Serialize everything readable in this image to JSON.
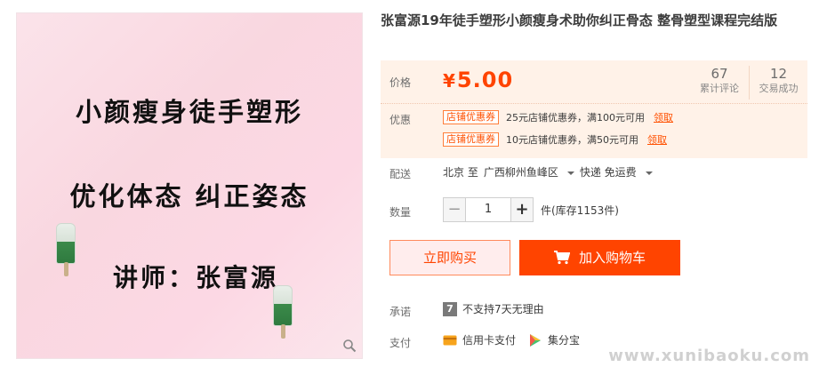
{
  "image": {
    "line1": "小颜瘦身徒手塑形",
    "line2": "优化体态  纠正姿态",
    "line3": "讲师：张富源"
  },
  "product": {
    "title": "张富源19年徒手塑形小颜瘦身术助你纠正骨态 整骨塑型课程完结版"
  },
  "price": {
    "label": "价格",
    "currency": "¥",
    "value": "5.00",
    "stats": [
      {
        "number": "67",
        "text": "累计评论"
      },
      {
        "number": "12",
        "text": "交易成功"
      }
    ]
  },
  "promo": {
    "label": "优惠",
    "coupons": [
      {
        "badge": "店铺优惠券",
        "text": "25元店铺优惠券，满100元可用",
        "link": "领取"
      },
      {
        "badge": "店铺优惠券",
        "text": "10元店铺优惠券，满50元可用",
        "link": "领取"
      }
    ]
  },
  "shipping": {
    "label": "配送",
    "from": "北京 至",
    "to": "广西柳州鱼峰区",
    "method": "快递 免运费"
  },
  "quantity": {
    "label": "数量",
    "value": "1",
    "minus": "−",
    "plus": "+",
    "stock": "件(库存1153件)"
  },
  "actions": {
    "buy_now": "立即购买",
    "add_cart": "加入购物车"
  },
  "promise": {
    "label": "承诺",
    "icon_text": "7",
    "text": "不支持7天无理由"
  },
  "payment": {
    "label": "支付",
    "methods": [
      {
        "icon": "credit-card-icon",
        "text": "信用卡支付"
      },
      {
        "icon": "jifenbao-icon",
        "text": "集分宝"
      }
    ]
  },
  "watermark": "www.xunibaoku.com",
  "colors": {
    "accent": "#ff4400",
    "price_panel_bg": "#fff2e8"
  }
}
